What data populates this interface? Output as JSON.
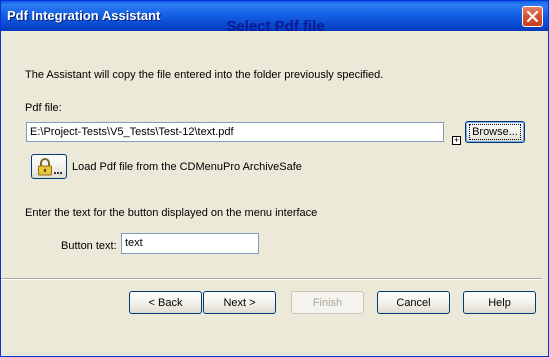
{
  "window": {
    "title": "Pdf Integration Assistant"
  },
  "page": {
    "heading": "Select Pdf file",
    "intro": "The Assistant will copy the file entered into the folder previously specified.",
    "pdf_file_label": "Pdf file:",
    "pdf_file_value": "E:\\Project-Tests\\V5_Tests\\Test-12\\text.pdf",
    "expand_glyph": "+",
    "browse_label": "Browse...",
    "load_label": "Load Pdf file from the CDMenuPro ArchiveSafe",
    "button_text_prompt": "Enter the text for the button displayed on the menu interface",
    "button_text_label": "Button text:",
    "button_text_value": "text"
  },
  "footer": {
    "back_label": "< Back",
    "next_label": "Next >",
    "finish_label": "Finish",
    "cancel_label": "Cancel",
    "help_label": "Help"
  },
  "icons": {
    "close": "close-icon",
    "lock": "padlock-icon"
  },
  "colors": {
    "titlebar": "#0a5fe8",
    "heading": "#0b1a96",
    "close_button": "#d6502f",
    "dialog_background": "#ece9d8"
  }
}
